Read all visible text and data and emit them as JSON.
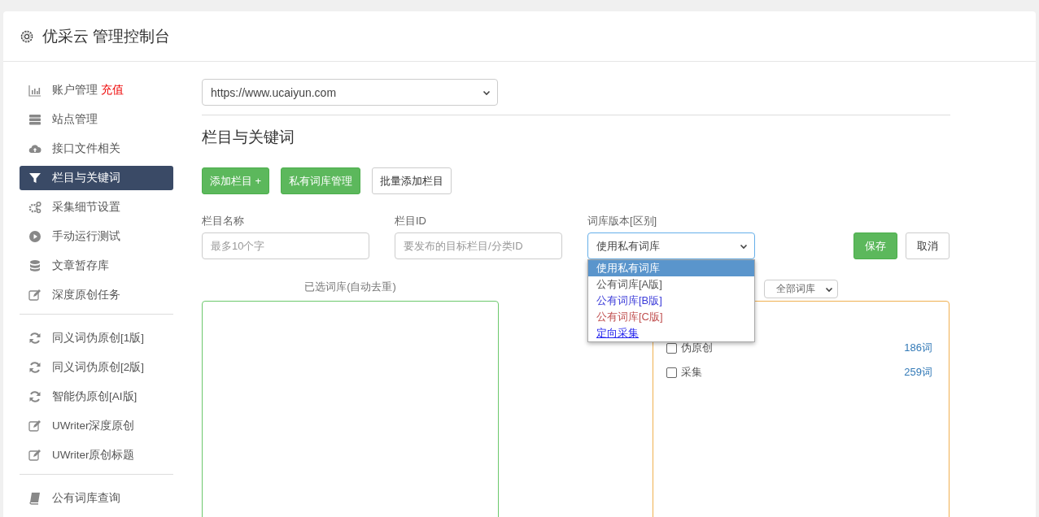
{
  "header": {
    "title": "优采云 管理控制台"
  },
  "sidebar": {
    "groups": [
      [
        {
          "label": "账户管理",
          "badge": "充值",
          "selected": false
        },
        {
          "label": "站点管理",
          "selected": false
        },
        {
          "label": "接口文件相关",
          "selected": false
        },
        {
          "label": "栏目与关键词",
          "selected": true
        },
        {
          "label": "采集细节设置",
          "selected": false
        },
        {
          "label": "手动运行测试",
          "selected": false
        },
        {
          "label": "文章暂存库",
          "selected": false
        },
        {
          "label": "深度原创任务",
          "selected": false
        }
      ],
      [
        {
          "label": "同义词伪原创[1版]",
          "selected": false
        },
        {
          "label": "同义词伪原创[2版]",
          "selected": false
        },
        {
          "label": "智能伪原创[AI版]",
          "selected": false
        },
        {
          "label": "UWriter深度原创",
          "selected": false
        },
        {
          "label": "UWriter原创标题",
          "selected": false
        }
      ],
      [
        {
          "label": "公有词库查询",
          "selected": false
        }
      ]
    ]
  },
  "site_select": {
    "value": "https://www.ucaiyun.com"
  },
  "section_title": "栏目与关键词",
  "actions": [
    {
      "label": "添加栏目 +",
      "kind": "primary"
    },
    {
      "label": "私有词库管理",
      "kind": "primary"
    },
    {
      "label": "批量添加栏目",
      "kind": "default"
    }
  ],
  "form": {
    "fields": [
      {
        "label": "栏目名称",
        "placeholder": "最多10个字"
      },
      {
        "label": "栏目ID",
        "placeholder": "要发布的目标栏目/分类ID"
      }
    ],
    "library": {
      "label": "词库版本[区别]",
      "value": "使用私有词库",
      "expanded": true,
      "options": [
        {
          "label": "使用私有词库",
          "selected": true,
          "kind": "plain"
        },
        {
          "label": "公有词库[A版]",
          "selected": false,
          "kind": "plain"
        },
        {
          "label": "公有词库[B版]",
          "selected": false,
          "kind": "b"
        },
        {
          "label": "公有词库[C版]",
          "selected": false,
          "kind": "c"
        },
        {
          "label": "定向采集",
          "selected": false,
          "kind": "link"
        }
      ]
    },
    "buttons": [
      {
        "label": "保存",
        "kind": "primary"
      },
      {
        "label": "取消",
        "kind": "default"
      }
    ]
  },
  "selected_panel": {
    "title": "已选词库(自动去重)"
  },
  "library_panel": {
    "filter": "全部词库",
    "items": [
      {
        "label": "伪原创",
        "count": "186词",
        "checked": false
      },
      {
        "label": "采集",
        "count": "259词",
        "checked": false
      }
    ]
  }
}
